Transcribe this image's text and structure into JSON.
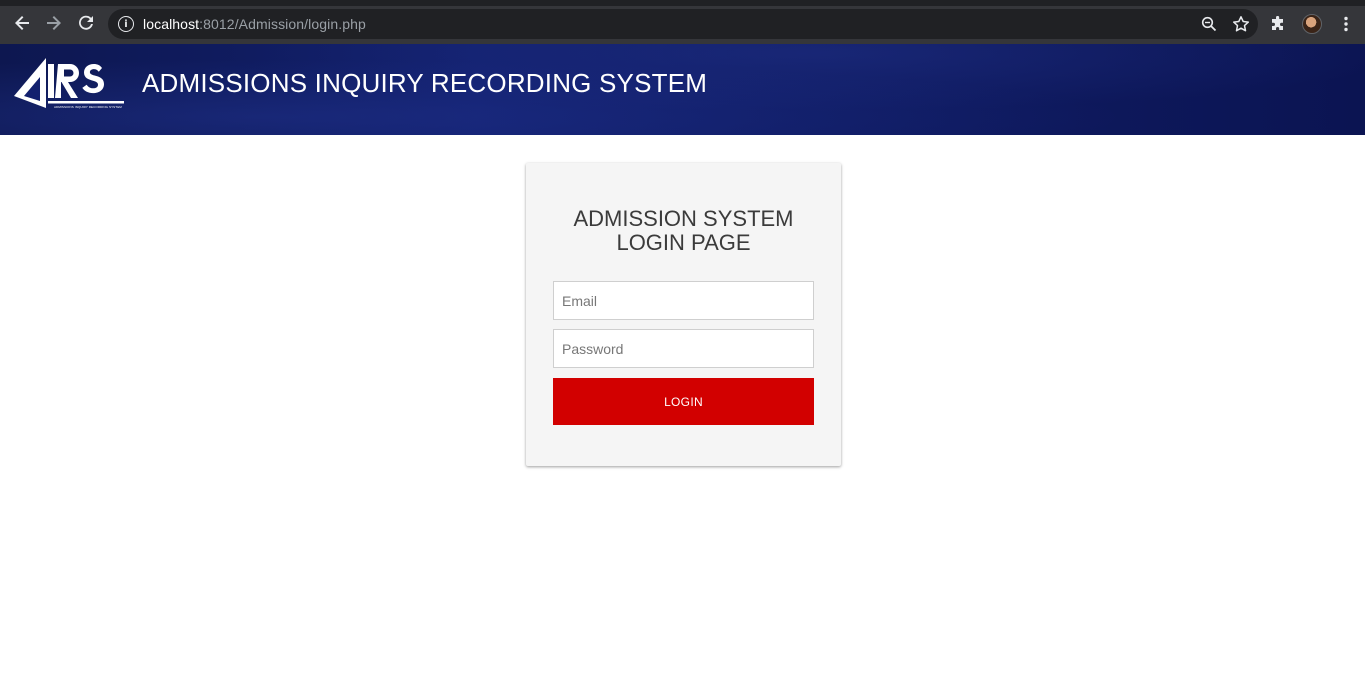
{
  "browser": {
    "url_host": "localhost",
    "url_rest": ":8012/Admission/login.php",
    "icons": {
      "back": "back-arrow-icon",
      "forward": "forward-arrow-icon",
      "reload": "reload-icon",
      "site_info": "info-icon",
      "zoom": "zoom-icon",
      "bookmark": "star-icon",
      "extensions": "puzzle-icon",
      "profile": "avatar",
      "menu": "kebab-menu-icon"
    },
    "info_glyph": "i"
  },
  "header": {
    "logo_text": "IRS",
    "logo_subtext": "ADMISSIONS INQUIRY RECORDING SYSTEM",
    "title": "ADMISSIONS INQUIRY RECORDING SYSTEM"
  },
  "login": {
    "title_line1": "ADMISSION SYSTEM",
    "title_line2": "LOGIN PAGE",
    "email_placeholder": "Email",
    "email_value": "",
    "password_placeholder": "Password",
    "password_value": "",
    "button_label": "LOGIN"
  },
  "colors": {
    "header_bg": "#12206e",
    "button_bg": "#d20000",
    "card_bg": "#f5f5f5",
    "chrome_bg": "#35363a"
  }
}
